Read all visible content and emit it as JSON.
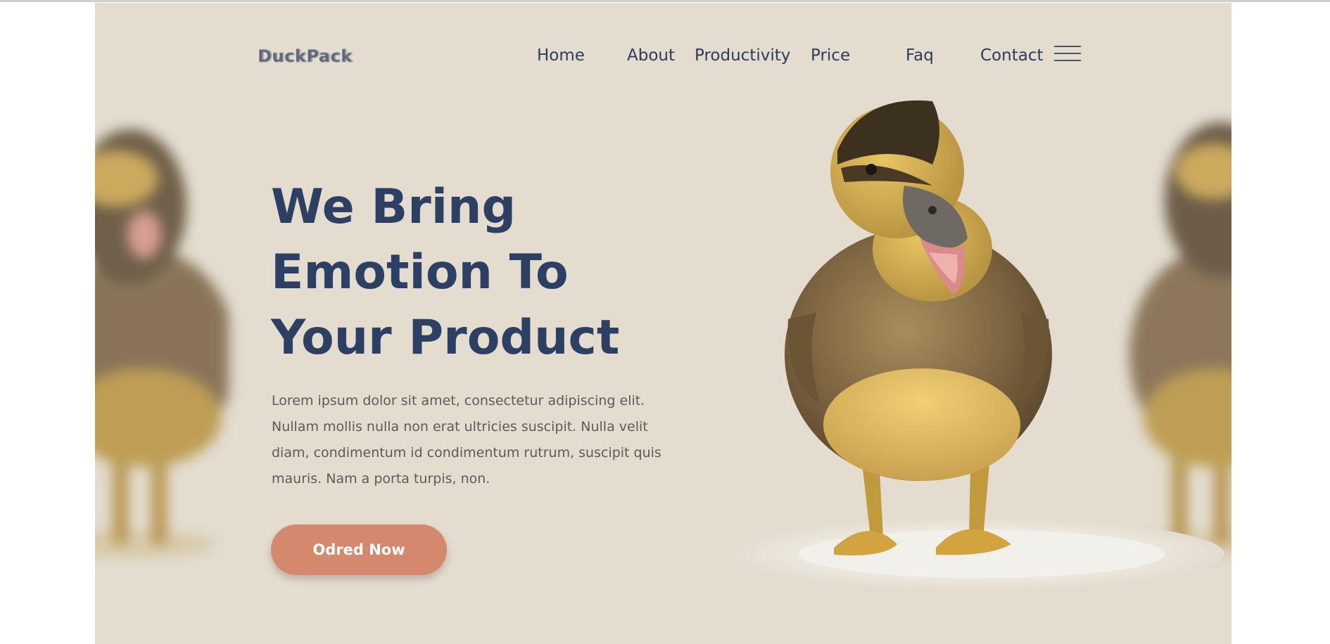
{
  "brand": {
    "logo_text": "DuckPack"
  },
  "nav": {
    "items": [
      {
        "label": "Home"
      },
      {
        "label": "About"
      },
      {
        "label": "Productivity"
      },
      {
        "label": "Price"
      },
      {
        "label": "Faq"
      },
      {
        "label": "Contact"
      }
    ],
    "menu_icon": "hamburger-menu-icon"
  },
  "hero": {
    "headline_lines": [
      "We Bring",
      "Emotion To",
      "Your Product"
    ],
    "paragraph": "Lorem ipsum dolor sit amet, consectetur adipiscing elit. Nullam mollis nulla non erat ultricies suscipit. Nulla velit diam, condimentum id condimentum rutrum, suscipit quis mauris. Nam a porta turpis, non.",
    "cta_label": "Odred Now",
    "image": "duckling-photo"
  },
  "colors": {
    "background": "#e3dccf",
    "headline": "#2d3f63",
    "nav_text": "#2d3b5c",
    "body_text": "#5b5b5b",
    "cta_bg": "#d4896f",
    "cta_text": "#ffffff"
  }
}
